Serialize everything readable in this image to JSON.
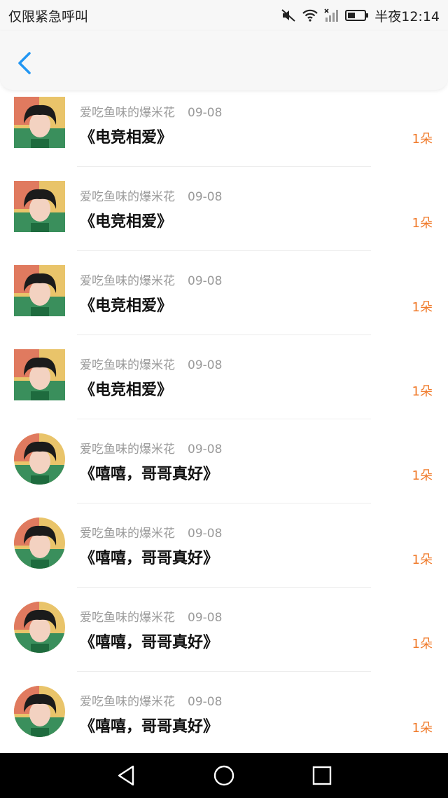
{
  "status_bar": {
    "left_text": "仅限紧急呼叫",
    "time": "半夜12:14"
  },
  "rows": [
    {
      "user": "爱吃鱼味的爆米花",
      "date": "09-08",
      "message": "《电竞相爱》",
      "count": "1朵",
      "avatar": "square"
    },
    {
      "user": "爱吃鱼味的爆米花",
      "date": "09-08",
      "message": "《电竞相爱》",
      "count": "1朵",
      "avatar": "square"
    },
    {
      "user": "爱吃鱼味的爆米花",
      "date": "09-08",
      "message": "《电竞相爱》",
      "count": "1朵",
      "avatar": "square"
    },
    {
      "user": "爱吃鱼味的爆米花",
      "date": "09-08",
      "message": "《电竞相爱》",
      "count": "1朵",
      "avatar": "square"
    },
    {
      "user": "爱吃鱼味的爆米花",
      "date": "09-08",
      "message": "《嘻嘻，哥哥真好》",
      "count": "1朵",
      "avatar": "round"
    },
    {
      "user": "爱吃鱼味的爆米花",
      "date": "09-08",
      "message": "《嘻嘻，哥哥真好》",
      "count": "1朵",
      "avatar": "round"
    },
    {
      "user": "爱吃鱼味的爆米花",
      "date": "09-08",
      "message": "《嘻嘻，哥哥真好》",
      "count": "1朵",
      "avatar": "round"
    },
    {
      "user": "爱吃鱼味的爆米花",
      "date": "09-08",
      "message": "《嘻嘻，哥哥真好》",
      "count": "1朵",
      "avatar": "round"
    }
  ],
  "colors": {
    "accent_blue": "#2196f3",
    "count_orange": "#f07a2a"
  }
}
